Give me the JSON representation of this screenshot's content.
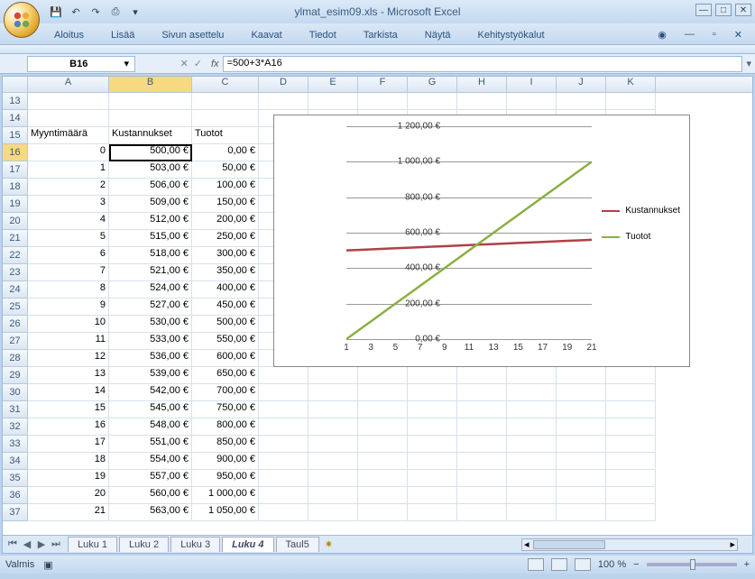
{
  "title": "ylmat_esim09.xls - Microsoft Excel",
  "qat": {
    "save": "💾",
    "undo": "↶",
    "redo": "↷",
    "print": "⎙"
  },
  "ribbon": [
    "Aloitus",
    "Lisää",
    "Sivun asettelu",
    "Kaavat",
    "Tiedot",
    "Tarkista",
    "Näytä",
    "Kehitystyökalut"
  ],
  "name_box": "B16",
  "formula": "=500+3*A16",
  "columns": [
    "A",
    "B",
    "C",
    "D",
    "E",
    "F",
    "G",
    "H",
    "I",
    "J",
    "K"
  ],
  "headers": {
    "A": "Myyntimäärä",
    "B": "Kustannukset",
    "C": "Tuotot"
  },
  "row_start": 13,
  "rows": [
    {
      "r": 13
    },
    {
      "r": 14
    },
    {
      "r": 15,
      "A": "Myyntimäärä",
      "B": "Kustannukset",
      "C": "Tuotot",
      "hdr": true
    },
    {
      "r": 16,
      "A": "0",
      "B": "500,00 €",
      "C": "0,00 €",
      "sel": true
    },
    {
      "r": 17,
      "A": "1",
      "B": "503,00 €",
      "C": "50,00 €"
    },
    {
      "r": 18,
      "A": "2",
      "B": "506,00 €",
      "C": "100,00 €"
    },
    {
      "r": 19,
      "A": "3",
      "B": "509,00 €",
      "C": "150,00 €"
    },
    {
      "r": 20,
      "A": "4",
      "B": "512,00 €",
      "C": "200,00 €"
    },
    {
      "r": 21,
      "A": "5",
      "B": "515,00 €",
      "C": "250,00 €"
    },
    {
      "r": 22,
      "A": "6",
      "B": "518,00 €",
      "C": "300,00 €"
    },
    {
      "r": 23,
      "A": "7",
      "B": "521,00 €",
      "C": "350,00 €"
    },
    {
      "r": 24,
      "A": "8",
      "B": "524,00 €",
      "C": "400,00 €"
    },
    {
      "r": 25,
      "A": "9",
      "B": "527,00 €",
      "C": "450,00 €"
    },
    {
      "r": 26,
      "A": "10",
      "B": "530,00 €",
      "C": "500,00 €"
    },
    {
      "r": 27,
      "A": "11",
      "B": "533,00 €",
      "C": "550,00 €"
    },
    {
      "r": 28,
      "A": "12",
      "B": "536,00 €",
      "C": "600,00 €"
    },
    {
      "r": 29,
      "A": "13",
      "B": "539,00 €",
      "C": "650,00 €"
    },
    {
      "r": 30,
      "A": "14",
      "B": "542,00 €",
      "C": "700,00 €"
    },
    {
      "r": 31,
      "A": "15",
      "B": "545,00 €",
      "C": "750,00 €"
    },
    {
      "r": 32,
      "A": "16",
      "B": "548,00 €",
      "C": "800,00 €"
    },
    {
      "r": 33,
      "A": "17",
      "B": "551,00 €",
      "C": "850,00 €"
    },
    {
      "r": 34,
      "A": "18",
      "B": "554,00 €",
      "C": "900,00 €"
    },
    {
      "r": 35,
      "A": "19",
      "B": "557,00 €",
      "C": "950,00 €"
    },
    {
      "r": 36,
      "A": "20",
      "B": "560,00 €",
      "C": "1 000,00 €"
    },
    {
      "r": 37,
      "A": "21",
      "B": "563,00 €",
      "C": "1 050,00 €"
    }
  ],
  "sheet_tabs": [
    "Luku 1",
    "Luku 2",
    "Luku 3",
    "Luku 4",
    "Taul5"
  ],
  "active_tab": "Luku 4",
  "status": "Valmis",
  "zoom": "100 %",
  "chart_data": {
    "type": "line",
    "x": [
      1,
      2,
      3,
      4,
      5,
      6,
      7,
      8,
      9,
      10,
      11,
      12,
      13,
      14,
      15,
      16,
      17,
      18,
      19,
      20,
      21
    ],
    "x_ticks": [
      1,
      3,
      5,
      7,
      9,
      11,
      13,
      15,
      17,
      19,
      21
    ],
    "y_ticks": [
      "0,00 €",
      "200,00 €",
      "400,00 €",
      "600,00 €",
      "800,00 €",
      "1 000,00 €",
      "1 200,00 €"
    ],
    "ylim": [
      0,
      1200
    ],
    "series": [
      {
        "name": "Kustannukset",
        "color": "#b04048",
        "values": [
          500,
          503,
          506,
          509,
          512,
          515,
          518,
          521,
          524,
          527,
          530,
          533,
          536,
          539,
          542,
          545,
          548,
          551,
          554,
          557,
          560
        ]
      },
      {
        "name": "Tuotot",
        "color": "#8ab040",
        "values": [
          0,
          50,
          100,
          150,
          200,
          250,
          300,
          350,
          400,
          450,
          500,
          550,
          600,
          650,
          700,
          750,
          800,
          850,
          900,
          950,
          1000
        ]
      }
    ]
  }
}
